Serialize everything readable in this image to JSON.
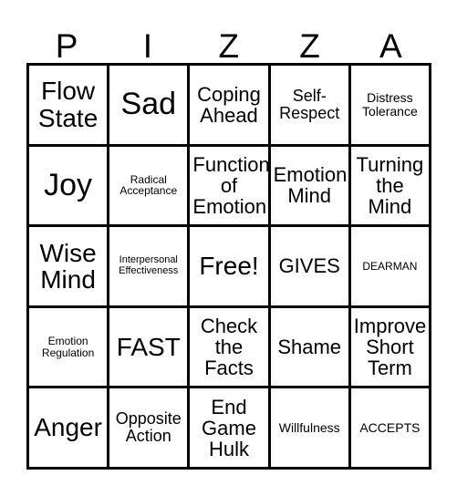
{
  "card": {
    "header_letters": [
      "P",
      "I",
      "Z",
      "Z",
      "A"
    ],
    "grid": {
      "rows": 5,
      "columns": 5,
      "cells": [
        {
          "text": "Flow State",
          "size": "t-lg"
        },
        {
          "text": "Sad",
          "size": "t-xl"
        },
        {
          "text": "Coping Ahead",
          "size": "t-md"
        },
        {
          "text": "Self-Respect",
          "size": "t-sm"
        },
        {
          "text": "Distress Tolerance",
          "size": "t-xs"
        },
        {
          "text": "Joy",
          "size": "t-xl"
        },
        {
          "text": "Radical Acceptance",
          "size": "t-xxs"
        },
        {
          "text": "Function of Emotion",
          "size": "t-md"
        },
        {
          "text": "Emotion Mind",
          "size": "t-md"
        },
        {
          "text": "Turning the Mind",
          "size": "t-md"
        },
        {
          "text": "Wise Mind",
          "size": "t-lg"
        },
        {
          "text": "Interpersonal Effectiveness",
          "size": "t-tiny"
        },
        {
          "text": "Free!",
          "size": "t-lg"
        },
        {
          "text": "GIVES",
          "size": "t-md"
        },
        {
          "text": "DEARMAN",
          "size": "t-xxs"
        },
        {
          "text": "Emotion Regulation",
          "size": "t-xxs"
        },
        {
          "text": "FAST",
          "size": "t-lg"
        },
        {
          "text": "Check the Facts",
          "size": "t-md"
        },
        {
          "text": "Shame",
          "size": "t-md"
        },
        {
          "text": "Improve Short Term",
          "size": "t-md"
        },
        {
          "text": "Anger",
          "size": "t-lg"
        },
        {
          "text": "Opposite Action",
          "size": "t-sm"
        },
        {
          "text": "End Game Hulk",
          "size": "t-md"
        },
        {
          "text": "Willfulness",
          "size": "t-xs"
        },
        {
          "text": "ACCEPTS",
          "size": "t-xs"
        }
      ]
    },
    "colors": {
      "ink": "#000000",
      "paper": "#ffffff"
    }
  }
}
